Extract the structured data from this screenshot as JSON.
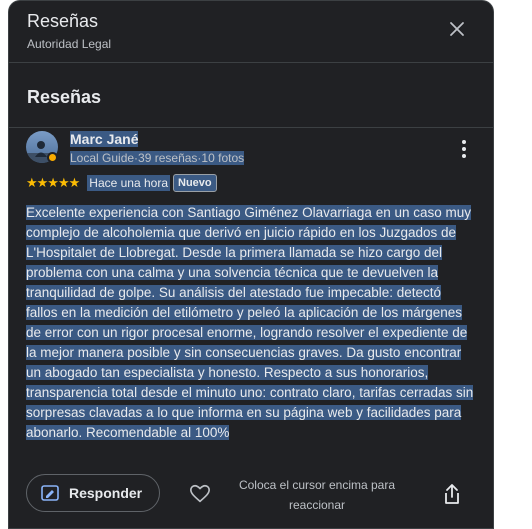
{
  "header": {
    "title": "Reseñas",
    "subtitle": "Autoridad Legal",
    "close_icon": "close-icon"
  },
  "section": {
    "title": "Reseñas"
  },
  "review": {
    "author": "Marc Jané",
    "meta_guide": "Local Guide",
    "meta_reviews": "39 reseñas",
    "meta_photos": "10 fotos",
    "meta_sep": "·",
    "rating": 5,
    "stars": "★★★★★",
    "time": "Hace una hora",
    "badge": "Nuevo",
    "text": "Excelente experiencia con Santiago Giménez Olavarriaga en un caso muy complejo de alcoholemia que derivó en juicio rápido en los Juzgados de L'Hospitalet de Llobregat. Desde la primera llamada se hizo cargo del problema con una calma y una solvencia técnica que te devuelven la tranquilidad de golpe. Su análisis del atestado fue impecable: detectó fallos en la medición del etilómetro y peleó la aplicación de los márgenes de error con un rigor procesal enorme, logrando resolver el expediente de la mejor manera posible y sin consecuencias graves. Da gusto encontrar un abogado tan especialista y honesto. Respecto a sus honorarios, transparencia total desde el minuto uno: contrato claro, tarifas cerradas sin sorpresas clavadas a lo que informa en su página web y facilidades para abonarlo. Recomendable al 100%"
  },
  "actions": {
    "reply_label": "Responder",
    "reply_icon": "reply-edit-icon",
    "like_icon": "heart-icon",
    "react_hint": "Coloca el cursor encima para reaccionar",
    "share_icon": "share-icon",
    "more_icon": "more-vert-icon"
  },
  "colors": {
    "background": "#202124",
    "text": "#e8eaed",
    "secondary_text": "#bdc1c6",
    "selection": "#3b5a84",
    "star": "#fbbc04"
  }
}
